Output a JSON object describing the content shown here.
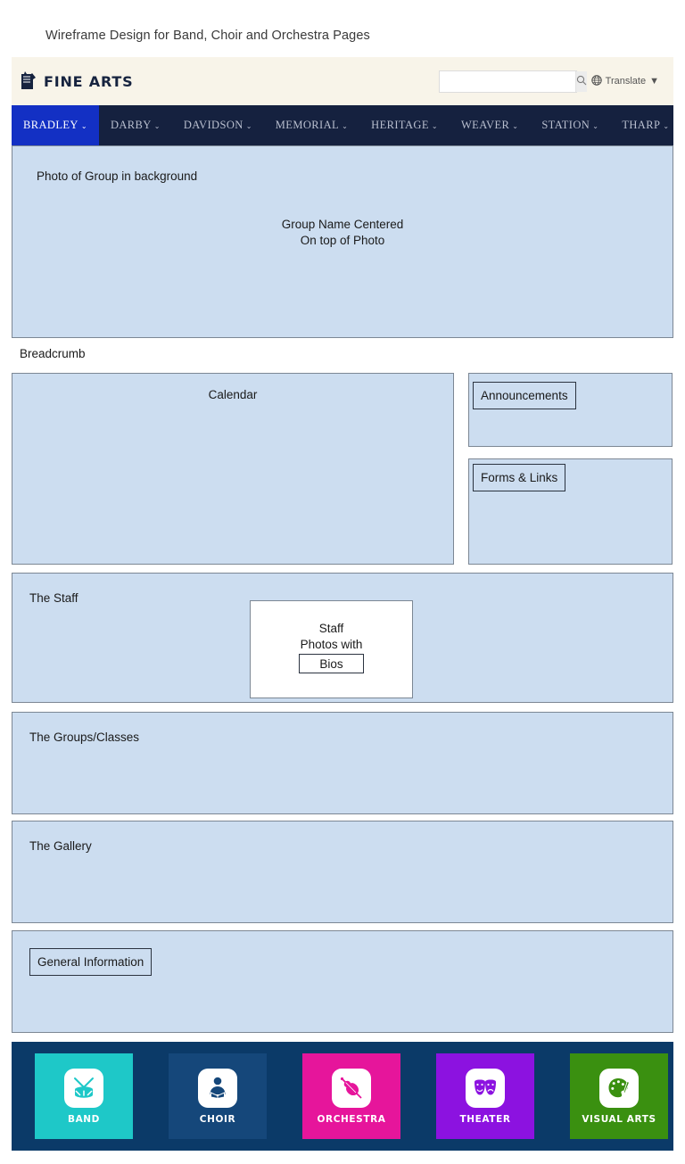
{
  "document": {
    "title": "Wireframe Design for Band, Choir and Orchestra Pages"
  },
  "header": {
    "logo_text": "FINE ARTS",
    "logo_icon": "fine-arts-brush-icon",
    "search": {
      "value": "",
      "placeholder": "",
      "button_icon": "search-icon"
    },
    "translate": {
      "label": "Translate",
      "icon": "globe-icon",
      "caret": "▼"
    }
  },
  "nav": {
    "items": [
      {
        "label": "BRADLEY",
        "caret": "⌄",
        "active": true
      },
      {
        "label": "DARBY",
        "caret": "⌄",
        "active": false
      },
      {
        "label": "DAVIDSON",
        "caret": "⌄",
        "active": false
      },
      {
        "label": "MEMORIAL",
        "caret": "⌄",
        "active": false
      },
      {
        "label": "HERITAGE",
        "caret": "⌄",
        "active": false
      },
      {
        "label": "WEAVER",
        "caret": "⌄",
        "active": false
      },
      {
        "label": "STATION",
        "caret": "⌄",
        "active": false
      },
      {
        "label": "THARP",
        "caret": "⌄",
        "active": false
      }
    ]
  },
  "hero": {
    "photo_label": "Photo of Group in background",
    "center_line_1": "Group Name Centered",
    "center_line_2": "On top of Photo"
  },
  "breadcrumb": {
    "label": "Breadcrumb"
  },
  "main": {
    "calendar_label": "Calendar",
    "announcements_label": "Announcements",
    "forms_links_label": "Forms & Links",
    "staff_label": "The Staff",
    "staff_photo_line_1": "Staff",
    "staff_photo_line_2": "Photos with",
    "bios_label": "Bios",
    "groups_label": "The Groups/Classes",
    "gallery_label": "The Gallery",
    "general_information_label": "General Information"
  },
  "footer": {
    "background": "#0b3a68",
    "tiles": [
      {
        "label": "BAND",
        "icon": "drum-icon",
        "color": "#1ec8c8"
      },
      {
        "label": "CHOIR",
        "icon": "singer-icon",
        "color": "#15477a"
      },
      {
        "label": "ORCHESTRA",
        "icon": "violin-icon",
        "color": "#e6159b"
      },
      {
        "label": "THEATER",
        "icon": "theater-masks-icon",
        "color": "#8c12e0"
      },
      {
        "label": "VISUAL ARTS",
        "icon": "palette-icon",
        "color": "#3a9010"
      }
    ]
  },
  "colors": {
    "wireframe_fill": "#ccddf0",
    "wireframe_border": "#7c8794",
    "header_cream": "#f8f4e9",
    "nav_navy": "#15213f",
    "nav_active_blue": "#1330c4"
  }
}
